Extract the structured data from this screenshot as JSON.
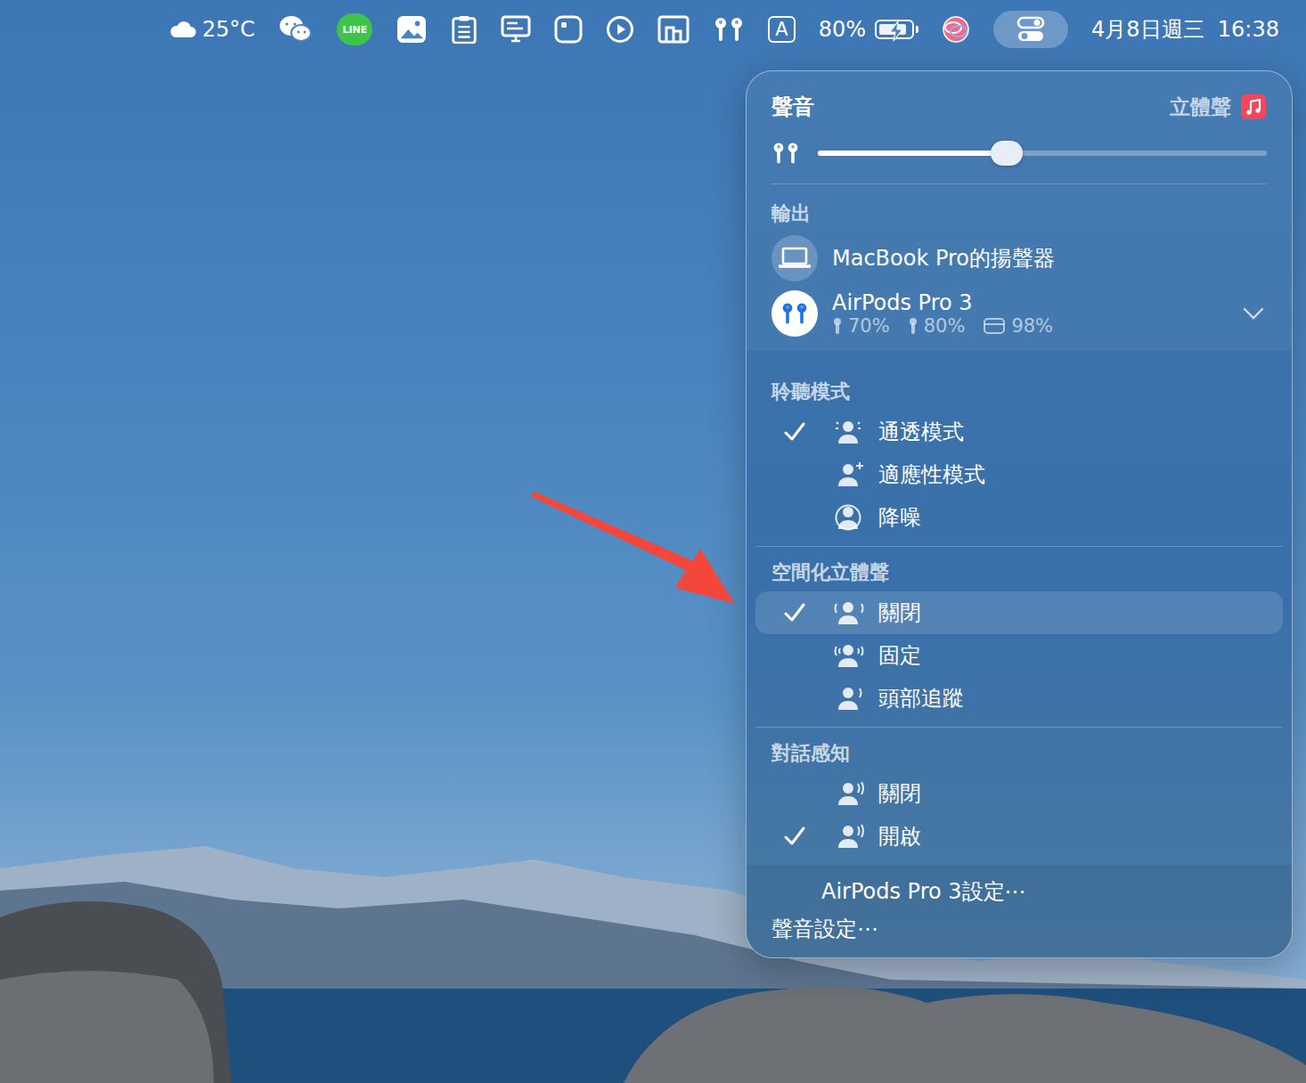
{
  "menubar": {
    "weather": "25°C",
    "line_logo": "LINE",
    "input_source": "A",
    "battery": {
      "text": "80%",
      "level": 0.8,
      "charging": true
    },
    "control_center": {
      "selected": true
    },
    "clock": "4月8日週三  16:38"
  },
  "panel": {
    "title": "聲音",
    "mode": "立體聲",
    "volume": {
      "level": 0.42
    },
    "output": {
      "title": "輸出",
      "devices": [
        {
          "name": "MacBook Pro的揚聲器",
          "selected": false,
          "kind": "speaker"
        },
        {
          "name": "AirPods Pro 3",
          "selected": true,
          "kind": "airpods",
          "expanded": false,
          "battery": {
            "left": "70%",
            "right": "80%",
            "case": "98%"
          }
        }
      ]
    },
    "sections": [
      {
        "title": "聆聽模式",
        "items": [
          {
            "label": "通透模式",
            "checked": true,
            "highlighted": false
          },
          {
            "label": "適應性模式",
            "checked": false,
            "highlighted": false
          },
          {
            "label": "降噪",
            "checked": false,
            "highlighted": false
          }
        ]
      },
      {
        "title": "空間化立體聲",
        "items": [
          {
            "label": "關閉",
            "checked": true,
            "highlighted": true
          },
          {
            "label": "固定",
            "checked": false,
            "highlighted": false
          },
          {
            "label": "頭部追蹤",
            "checked": false,
            "highlighted": false
          }
        ]
      },
      {
        "title": "對話感知",
        "items": [
          {
            "label": "關閉",
            "checked": false,
            "highlighted": false
          },
          {
            "label": "開啟",
            "checked": true,
            "highlighted": false
          }
        ]
      }
    ],
    "footer": [
      "AirPods Pro 3設定⋯",
      "聲音設定⋯"
    ]
  }
}
